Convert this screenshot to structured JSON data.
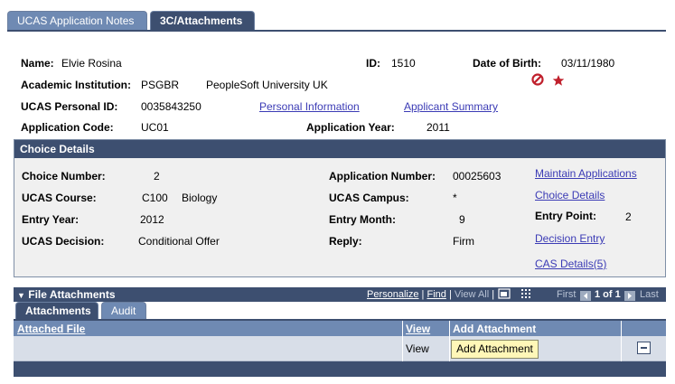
{
  "tabs": [
    {
      "label": "UCAS Application Notes",
      "active": false
    },
    {
      "label": "3C/Attachments",
      "active": true
    }
  ],
  "header": {
    "name_label": "Name:",
    "name_value": "Elvie Rosina",
    "id_label": "ID:",
    "id_value": "1510",
    "dob_label": "Date of Birth:",
    "dob_value": "03/11/1980",
    "institution_label": "Academic Institution:",
    "institution_code": "PSGBR",
    "institution_name": "PeopleSoft University UK",
    "personal_id_label": "UCAS Personal ID:",
    "personal_id_value": "0035843250",
    "personal_info_link": "Personal Information",
    "applicant_summary_link": "Applicant Summary",
    "app_code_label": "Application Code:",
    "app_code_value": "UC01",
    "app_year_label": "Application Year:",
    "app_year_value": "2011"
  },
  "choice_details": {
    "title": "Choice Details",
    "choice_number_label": "Choice Number:",
    "choice_number_value": "2",
    "ucas_course_label": "UCAS Course:",
    "course_code": "C100",
    "course_name": "Biology",
    "entry_year_label": "Entry Year:",
    "entry_year_value": "2012",
    "decision_label": "UCAS Decision:",
    "decision_value": "Conditional Offer",
    "app_number_label": "Application Number:",
    "app_number_value": "00025603",
    "campus_label": "UCAS Campus:",
    "campus_value": "*",
    "entry_month_label": "Entry Month:",
    "entry_month_value": "9",
    "reply_label": "Reply:",
    "reply_value": "Firm",
    "entry_point_label": "Entry Point:",
    "entry_point_value": "2",
    "links": {
      "maintain_applications": "Maintain Applications",
      "choice_details": "Choice Details",
      "decision_entry": "Decision Entry",
      "cas_details": "CAS Details(5)"
    }
  },
  "file_attachments": {
    "title": "File Attachments",
    "nav": {
      "personalize": "Personalize",
      "sep1": "|",
      "find": "Find",
      "sep2": "|",
      "view_all": "View All",
      "sep3": "|",
      "first": "First",
      "range": "1 of 1",
      "last": "Last"
    },
    "subtabs": [
      {
        "label": "Attachments",
        "active": true
      },
      {
        "label": "Audit",
        "active": false
      }
    ],
    "columns": {
      "attached_file": "Attached File",
      "view": "View",
      "add_attachment": "Add Attachment"
    },
    "rows": [
      {
        "attached_file": "",
        "view": "View",
        "add_button": "Add Attachment"
      }
    ]
  },
  "icons": {
    "no_entry": "no-entry-icon",
    "star": "star-icon"
  },
  "colors": {
    "header_blue": "#3d4f70",
    "tab_inactive": "#6f8ab3",
    "link": "#3b3bb5",
    "no_entry_red": "#c0202c",
    "row_bg": "#d8dee8",
    "add_button_bg": "#fff7b8"
  }
}
